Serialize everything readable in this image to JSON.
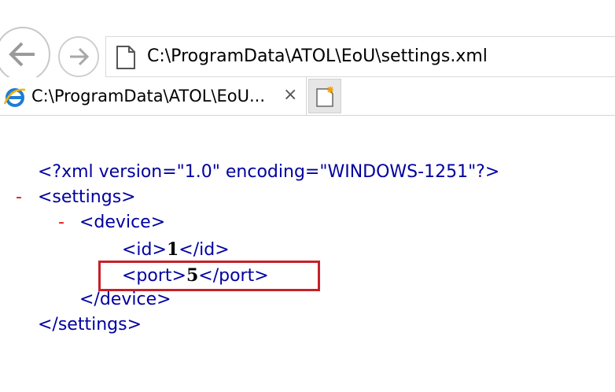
{
  "browser": {
    "address": "C:\\ProgramData\\ATOL\\EoU\\settings.xml",
    "tab_title": "C:\\ProgramData\\ATOL\\EoU...",
    "tab_close": "×",
    "icons": [
      "back-arrow-icon",
      "forward-arrow-icon",
      "page-icon",
      "ie-icon",
      "close-icon",
      "new-tab-icon"
    ]
  },
  "xml": {
    "declaration": "<?xml version=\"1.0\" encoding=\"WINDOWS-1251\"?>",
    "collapse_marker": "-",
    "settings_open": "<settings>",
    "device_open": "<device>",
    "id_open": "<id>",
    "id_value": "1",
    "id_close": "</id>",
    "port_open": "<port>",
    "port_value": "5",
    "port_close": "</port>",
    "device_close": "</device>",
    "settings_close": "</settings>"
  },
  "colors": {
    "tag": "#0000a0",
    "collapse": "#e01010",
    "highlight": "#c8202a"
  }
}
